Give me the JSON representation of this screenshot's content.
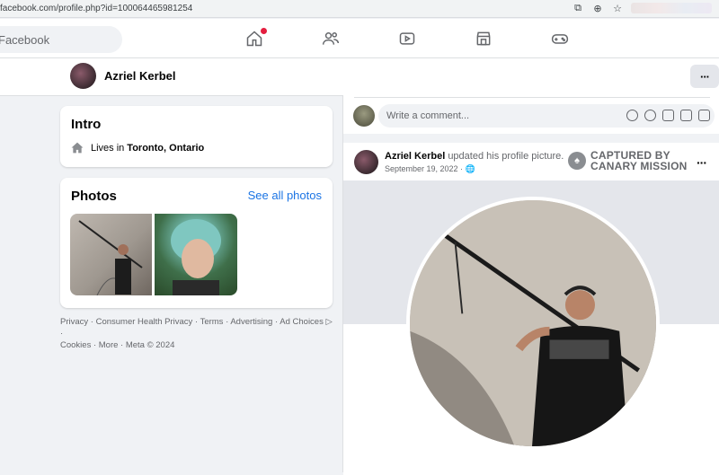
{
  "browser": {
    "url": "facebook.com/profile.php?id=100064465981254",
    "icons": [
      "cast-icon",
      "zoom-icon",
      "star-icon"
    ]
  },
  "topnav": {
    "search_placeholder": "Facebook",
    "nav_icons": [
      "home-icon",
      "friends-icon",
      "watch-icon",
      "marketplace-icon",
      "gaming-icon"
    ],
    "notification_color": "#e41e3f"
  },
  "profile": {
    "name": "Azriel Kerbel",
    "more_label": "···"
  },
  "intro": {
    "title": "Intro",
    "lives_prefix": "Lives in",
    "lives_location": "Toronto, Ontario"
  },
  "photos": {
    "title": "Photos",
    "see_all": "See all photos"
  },
  "footer": {
    "line1": "Privacy · Consumer Health Privacy · Terms · Advertising · Ad Choices ▷ ·",
    "line2": "Cookies · More · Meta © 2024"
  },
  "comment": {
    "placeholder": "Write a comment..."
  },
  "post": {
    "author": "Azriel Kerbel",
    "action": "updated his profile picture.",
    "date": "September 19, 2022 · ",
    "captured_line1": "CAPTURED BY",
    "captured_line2": "CANARY MISSION",
    "more_label": "···"
  },
  "colors": {
    "link": "#1b74e4",
    "bg": "#f0f2f5"
  }
}
